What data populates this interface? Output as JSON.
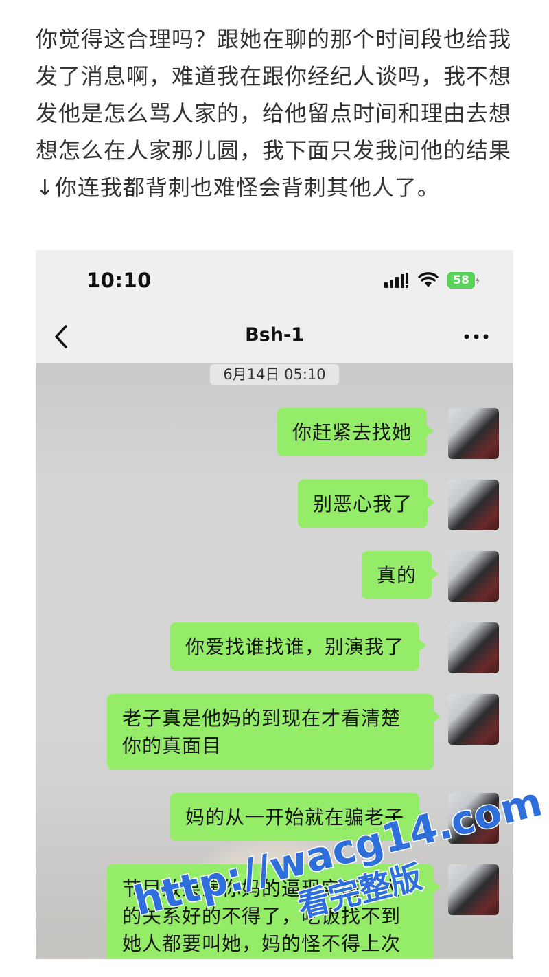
{
  "post": {
    "text": "你觉得这合理吗？跟她在聊的那个时间段也给我发了消息啊，难道我在跟你经纪人谈吗，我不想发他是怎么骂人家的，给他留点时间和理由去想想怎么在人家那儿圆，我下面只发我问他的结果↓你连我都背刺也难怪会背刺其他人了。"
  },
  "status_bar": {
    "time": "10:10",
    "battery": "58"
  },
  "chat": {
    "title": "Bsh-1",
    "timestamp": "6月14日 05:10",
    "messages": [
      {
        "text": "你赶紧去找她"
      },
      {
        "text": "别恶心我了"
      },
      {
        "text": "真的"
      },
      {
        "text": "你爱找谁找谁，别演我了"
      },
      {
        "text": "老子真是他妈的到现在才看清楚你的真面目"
      },
      {
        "text": "妈的从一开始就在骗老子"
      },
      {
        "text": "节目效果演你妈的逼现实两个人的关系好的不得了，吃饭找不到她人都要叫她，妈的怪不得上次"
      }
    ]
  },
  "watermark": {
    "line1": "http://wacg14.com",
    "line2": "看完整版"
  },
  "colors": {
    "bubble": "#95ec69",
    "watermark": "#2f6fdb",
    "battery": "#5ad35a"
  }
}
